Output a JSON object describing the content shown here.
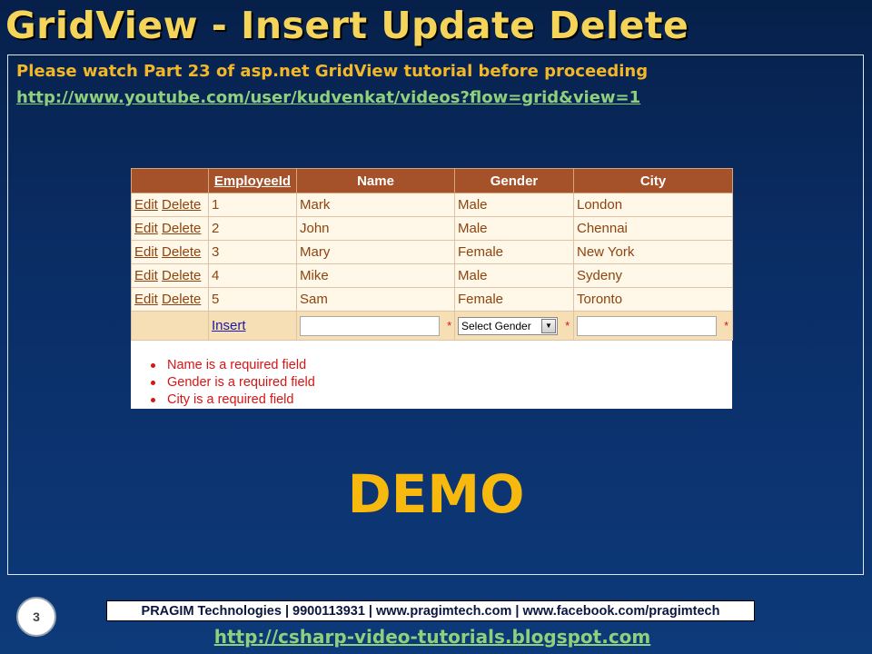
{
  "slide": {
    "title": "GridView - Insert Update Delete",
    "intro_text": "Please watch Part 23 of asp.net GridView tutorial before proceeding",
    "intro_link": "http://www.youtube.com/user/kudvenkat/videos?flow=grid&view=1",
    "demo_text": "DEMO",
    "page_number": "3",
    "footer_text": "PRAGIM Technologies | 9900113931 | www.pragimtech.com | www.facebook.com/pragimtech",
    "footer_link": "http://csharp-video-tutorials.blogspot.com"
  },
  "grid": {
    "columns": [
      "",
      "EmployeeId",
      "Name",
      "Gender",
      "City"
    ],
    "edit_label": "Edit",
    "delete_label": "Delete",
    "rows": [
      {
        "id": "1",
        "name": "Mark",
        "gender": "Male",
        "city": "London"
      },
      {
        "id": "2",
        "name": "John",
        "gender": "Male",
        "city": "Chennai"
      },
      {
        "id": "3",
        "name": "Mary",
        "gender": "Female",
        "city": "New York"
      },
      {
        "id": "4",
        "name": "Mike",
        "gender": "Male",
        "city": "Sydeny"
      },
      {
        "id": "5",
        "name": "Sam",
        "gender": "Female",
        "city": "Toronto"
      }
    ],
    "insert_label": "Insert",
    "name_input_value": "",
    "gender_select_value": "Select Gender",
    "city_input_value": "",
    "required_marker": "*"
  },
  "validation": {
    "errors": [
      "Name is a required field",
      "Gender is a required field",
      "City is a required field"
    ]
  },
  "colors": {
    "title": "#f5d45a",
    "header_bg": "#a55129",
    "row_bg": "#fff7e7",
    "error": "#d81414",
    "demo": "#f7b90d",
    "link": "#8fd07b"
  },
  "icons": {
    "dropdown_arrow": "chevron-down-icon",
    "error_bullet": "bullet-icon"
  }
}
